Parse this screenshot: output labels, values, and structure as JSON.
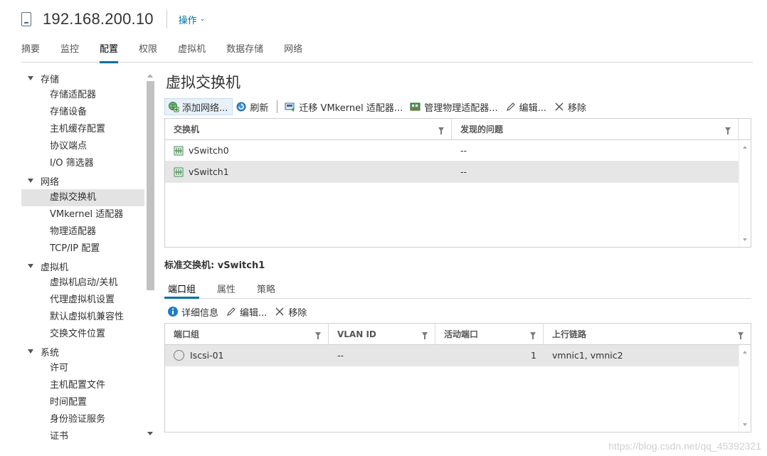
{
  "header": {
    "host": "192.168.200.10",
    "actions_label": "操作"
  },
  "main_tabs": [
    "摘要",
    "监控",
    "配置",
    "权限",
    "虚拟机",
    "数据存储",
    "网络"
  ],
  "main_tab_active": "配置",
  "nav": {
    "groups": [
      {
        "label": "存储",
        "items": [
          "存储适配器",
          "存储设备",
          "主机缓存配置",
          "协议端点",
          "I/O 筛选器"
        ]
      },
      {
        "label": "网络",
        "items": [
          "虚拟交换机",
          "VMkernel 适配器",
          "物理适配器",
          "TCP/IP 配置"
        ]
      },
      {
        "label": "虚拟机",
        "items": [
          "虚拟机启动/关机",
          "代理虚拟机设置",
          "默认虚拟机兼容性",
          "交换文件位置"
        ]
      },
      {
        "label": "系统",
        "items": [
          "许可",
          "主机配置文件",
          "时间配置",
          "身份验证服务",
          "证书"
        ]
      }
    ],
    "selected": "虚拟交换机"
  },
  "page_title": "虚拟交换机",
  "toolbar": {
    "add_network": "添加网络...",
    "refresh": "刷新",
    "migrate_vmkernel": "迁移 VMkernel 适配器...",
    "manage_physical": "管理物理适配器...",
    "edit": "编辑...",
    "remove": "移除"
  },
  "switch_grid": {
    "columns": [
      "交换机",
      "发现的问题"
    ],
    "rows": [
      {
        "name": "vSwitch0",
        "issues": "--"
      },
      {
        "name": "vSwitch1",
        "issues": "--"
      }
    ]
  },
  "detail": {
    "title": "标准交换机: vSwitch1",
    "tabs": [
      "端口组",
      "属性",
      "策略"
    ],
    "active_tab": "端口组",
    "toolbar": {
      "details": "详细信息",
      "edit": "编辑...",
      "remove": "移除"
    }
  },
  "portgroup_grid": {
    "columns": [
      "端口组",
      "VLAN ID",
      "活动端口",
      "上行链路"
    ],
    "rows": [
      {
        "name": "Iscsi-01",
        "vlan": "--",
        "active_ports": "1",
        "uplinks": "vmnic1, vmnic2"
      }
    ]
  },
  "watermark": "https://blog.csdn.net/qq_45392321",
  "colors": {
    "accent": "#0072a3",
    "selected_row": "#e6e6e6"
  }
}
